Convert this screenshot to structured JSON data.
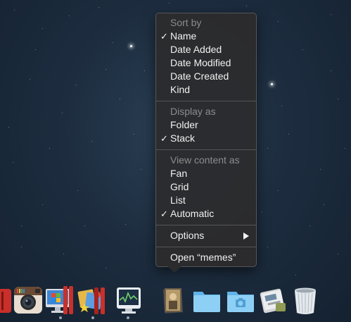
{
  "menu": {
    "checkmark": "✓",
    "sort_header": "Sort by",
    "sort_items": [
      {
        "label": "Name",
        "checked": true
      },
      {
        "label": "Date Added",
        "checked": false
      },
      {
        "label": "Date Modified",
        "checked": false
      },
      {
        "label": "Date Created",
        "checked": false
      },
      {
        "label": "Kind",
        "checked": false
      }
    ],
    "display_header": "Display as",
    "display_items": [
      {
        "label": "Folder",
        "checked": false
      },
      {
        "label": "Stack",
        "checked": true
      }
    ],
    "view_header": "View content as",
    "view_items": [
      {
        "label": "Fan",
        "checked": false
      },
      {
        "label": "Grid",
        "checked": false
      },
      {
        "label": "List",
        "checked": false
      },
      {
        "label": "Automatic",
        "checked": true
      }
    ],
    "options_label": "Options",
    "open_label": "Open “memes”"
  },
  "dock": {
    "items": [
      {
        "name": "red-app-icon",
        "running": false
      },
      {
        "name": "instagram-icon",
        "running": false
      },
      {
        "name": "parallels-windows-icon",
        "running": true
      },
      {
        "name": "stickies-game-icon",
        "running": true
      },
      {
        "name": "activity-monitor-icon",
        "running": true
      },
      {
        "name": "memes-stack-icon",
        "running": false
      },
      {
        "name": "folder-icon",
        "running": false
      },
      {
        "name": "screenshots-folder-icon",
        "running": false
      },
      {
        "name": "archive-utility-icon",
        "running": false
      },
      {
        "name": "trash-icon",
        "running": false
      }
    ]
  },
  "colors": {
    "menu_bg": "#2c2c2e",
    "menu_text": "#f2f2f2",
    "menu_header_text": "#8c8c8e",
    "wallpaper": "#1d2d3f"
  }
}
